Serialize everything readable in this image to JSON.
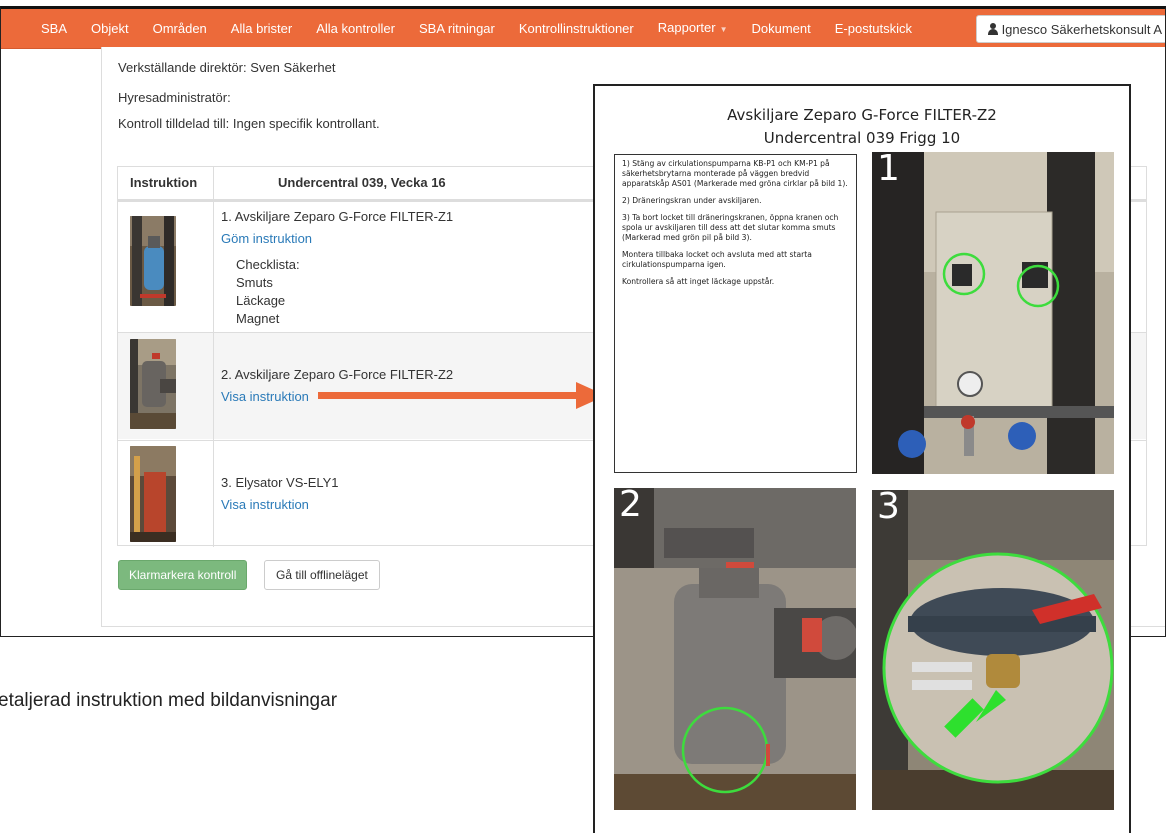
{
  "navbar": {
    "brand": "SBA",
    "items": [
      "Objekt",
      "Områden",
      "Alla brister",
      "Alla kontroller",
      "SBA ritningar",
      "Kontrollinstruktioner",
      "Rapporter",
      "Dokument",
      "E-postutskick"
    ],
    "user": "Ignesco Säkerhetskonsult A"
  },
  "info": {
    "ceo": "Verkställande direktör: Sven Säkerhet",
    "admin": "Hyresadministratör:",
    "assigned": "Kontroll tilldelad till: Ingen specifik kontrollant."
  },
  "table": {
    "col_instruction": "Instruktion",
    "col_title": "Undercentral 039, Vecka 16",
    "rows": [
      {
        "title": "1. Avskiljare Zeparo G-Force FILTER-Z1",
        "link": "Göm instruktion",
        "checklist_title": "Checklista:",
        "checklist": [
          "Smuts",
          "Läckage",
          "Magnet"
        ]
      },
      {
        "title": "2. Avskiljare Zeparo G-Force FILTER-Z2",
        "link": "Visa instruktion"
      },
      {
        "title": "3. Elysator VS-ELY1",
        "link": "Visa instruktion"
      }
    ]
  },
  "buttons": {
    "complete": "Klarmarkera kontroll",
    "offline": "Gå till offlineläget"
  },
  "caption": "etaljerad instruktion med bildanvisningar",
  "doc": {
    "title_line1": "Avskiljare Zeparo G-Force FILTER-Z2",
    "title_line2": "Undercentral 039 Frigg 10",
    "steps": [
      "1) Stäng av cirkulationspumparna KB-P1 och KM-P1 på säkerhetsbrytarna monterade på väggen bredvid apparatskåp AS01 (Markerade med gröna cirklar på bild 1).",
      "2) Dräneringskran under avskiljaren.",
      "3) Ta bort locket till dräneringskranen, öppna kranen och spola ur avskiljaren till dess att det slutar komma smuts (Markerad med grön pil på bild 3).",
      "Montera tillbaka locket och avsluta med att starta cirkulationspumparna igen.",
      "Kontrollera så att inget läckage uppstår."
    ],
    "photo_labels": [
      "1",
      "2",
      "3"
    ]
  },
  "colors": {
    "navbar": "#ec6a3a",
    "arrow": "#ec6a3a",
    "link": "#2a7ab8",
    "success_button": "#7cb97e",
    "marker_green": "#3ddc3d"
  }
}
